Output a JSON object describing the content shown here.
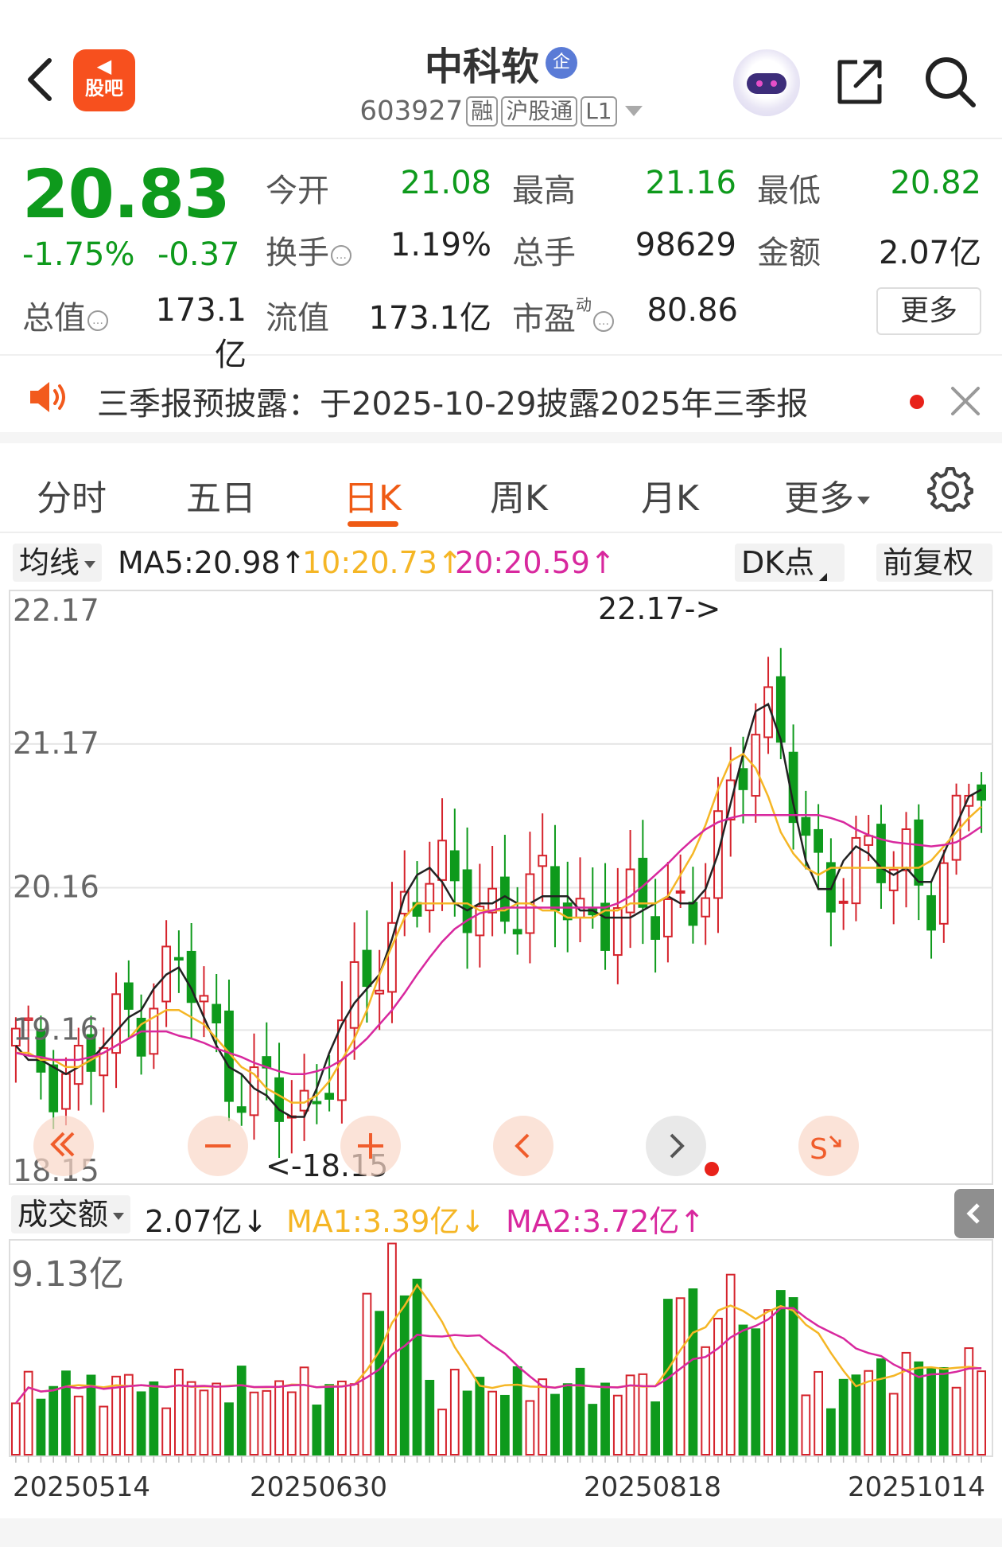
{
  "header": {
    "guba_logo_text": "股吧",
    "stock_name": "中科软",
    "qiye_badge": "企",
    "code": "603927",
    "tags": [
      "融",
      "沪股通",
      "L1"
    ]
  },
  "quote": {
    "price": "20.83",
    "change_pct": "-1.75%",
    "change_abs": "-0.37",
    "open_label": "今开",
    "open_value": "21.08",
    "high_label": "最高",
    "high_value": "21.16",
    "low_label": "最低",
    "low_value": "20.82",
    "turnover_label": "换手",
    "turnover_value": "1.19%",
    "volume_label": "总手",
    "volume_value": "98629",
    "amount_label": "金额",
    "amount_value": "2.07亿",
    "mcap_label": "总值",
    "mcap_value": "173.1亿",
    "float_label": "流值",
    "float_value": "173.1亿",
    "pe_label": "市盈",
    "pe_sup": "动",
    "pe_value": "80.86",
    "more_label": "更多"
  },
  "notice": {
    "text": "三季报预披露：于2025-10-29披露2025年三季报"
  },
  "tabs": {
    "items": [
      "分时",
      "五日",
      "日K",
      "周K",
      "月K",
      "更多"
    ],
    "active": "日K"
  },
  "ma_bar": {
    "select_label": "均线",
    "ma5": "MA5:20.98↑",
    "ma10": "10:20.73↑",
    "ma20": "20:20.59↑",
    "dk_label": "DK点",
    "adjust_label": "前复权",
    "ma5_color": "#222222",
    "ma10_color": "#f5b625",
    "ma20_color": "#d8289e"
  },
  "colors": {
    "up": "#d5232c",
    "down": "#0e9a1c",
    "accent": "#ef5a14"
  },
  "chart_data": {
    "type": "candlestick",
    "price_axis_labels": [
      "22.17",
      "21.17",
      "20.16",
      "19.16",
      "18.15"
    ],
    "ylim": [
      18.15,
      22.17
    ],
    "high_annotation": "22.17->",
    "low_annotation": "<-18.15",
    "x_tick_labels": [
      "20250514",
      "20250630",
      "20250818",
      "20251014"
    ],
    "volume_panel": {
      "select_label": "成交额",
      "current": "2.07亿↓",
      "ma1": "MA1:3.39亿↓",
      "ma2": "MA2:3.72亿↑",
      "max_label": "9.13亿",
      "ma1_color": "#f5b625",
      "ma2_color": "#d8289e"
    },
    "ma_series": [
      {
        "name": "MA5",
        "color": "#222222",
        "values": [
          19.05,
          18.95,
          18.95,
          18.9,
          18.85,
          18.9,
          18.95,
          19.05,
          19.15,
          19.25,
          19.3,
          19.45,
          19.55,
          19.6,
          19.45,
          19.25,
          19.05,
          18.9,
          18.85,
          18.75,
          18.7,
          18.6,
          18.55,
          18.55,
          18.75,
          19.0,
          19.2,
          19.35,
          19.45,
          19.55,
          19.8,
          20.1,
          20.25,
          20.3,
          20.2,
          20.05,
          20.0,
          20.05,
          20.05,
          20.1,
          20.05,
          20.05,
          20.1,
          20.1,
          20.1,
          20.0,
          20.0,
          19.95,
          19.95,
          19.95,
          20.0,
          20.05,
          20.1,
          20.05,
          20.05,
          20.15,
          20.4,
          20.75,
          21.1,
          21.4,
          21.45,
          21.2,
          20.75,
          20.35,
          20.15,
          20.15,
          20.35,
          20.45,
          20.4,
          20.3,
          20.25,
          20.3,
          20.2,
          20.2,
          20.4,
          20.6,
          20.8,
          20.85
        ]
      },
      {
        "name": "MA10",
        "color": "#f5b625",
        "values": [
          19.0,
          19.0,
          18.95,
          18.95,
          18.9,
          18.9,
          18.95,
          19.0,
          19.05,
          19.1,
          19.2,
          19.25,
          19.3,
          19.3,
          19.25,
          19.2,
          19.1,
          19.0,
          18.9,
          18.85,
          18.75,
          18.7,
          18.65,
          18.65,
          18.7,
          18.8,
          18.95,
          19.1,
          19.3,
          19.55,
          19.75,
          19.95,
          20.05,
          20.05,
          20.05,
          20.05,
          20.05,
          20.0,
          20.0,
          20.0,
          20.05,
          20.05,
          20.0,
          20.0,
          19.95,
          19.95,
          19.95,
          20.0,
          20.0,
          20.05,
          20.05,
          20.05,
          20.1,
          20.25,
          20.4,
          20.6,
          20.85,
          21.05,
          21.1,
          21.0,
          20.8,
          20.55,
          20.4,
          20.3,
          20.25,
          20.3,
          20.3,
          20.3,
          20.3,
          20.3,
          20.3,
          20.3,
          20.3,
          20.35,
          20.45,
          20.55,
          20.65,
          20.73
        ]
      },
      {
        "name": "MA20",
        "color": "#d8289e",
        "values": [
          19.0,
          18.98,
          18.97,
          18.95,
          18.95,
          18.95,
          18.97,
          19.0,
          19.05,
          19.1,
          19.15,
          19.15,
          19.15,
          19.12,
          19.1,
          19.07,
          19.03,
          19.0,
          18.97,
          18.93,
          18.9,
          18.87,
          18.85,
          18.85,
          18.87,
          18.9,
          18.95,
          19.02,
          19.1,
          19.2,
          19.3,
          19.42,
          19.55,
          19.67,
          19.78,
          19.87,
          19.93,
          19.98,
          20.0,
          20.02,
          20.02,
          20.02,
          20.02,
          20.02,
          20.02,
          20.02,
          20.02,
          20.02,
          20.05,
          20.1,
          20.17,
          20.25,
          20.33,
          20.42,
          20.5,
          20.57,
          20.62,
          20.65,
          20.67,
          20.67,
          20.67,
          20.67,
          20.67,
          20.67,
          20.67,
          20.65,
          20.62,
          20.57,
          20.53,
          20.5,
          20.48,
          20.47,
          20.46,
          20.45,
          20.46,
          20.48,
          20.53,
          20.59
        ]
      }
    ],
    "volume_max": 9.13
  }
}
